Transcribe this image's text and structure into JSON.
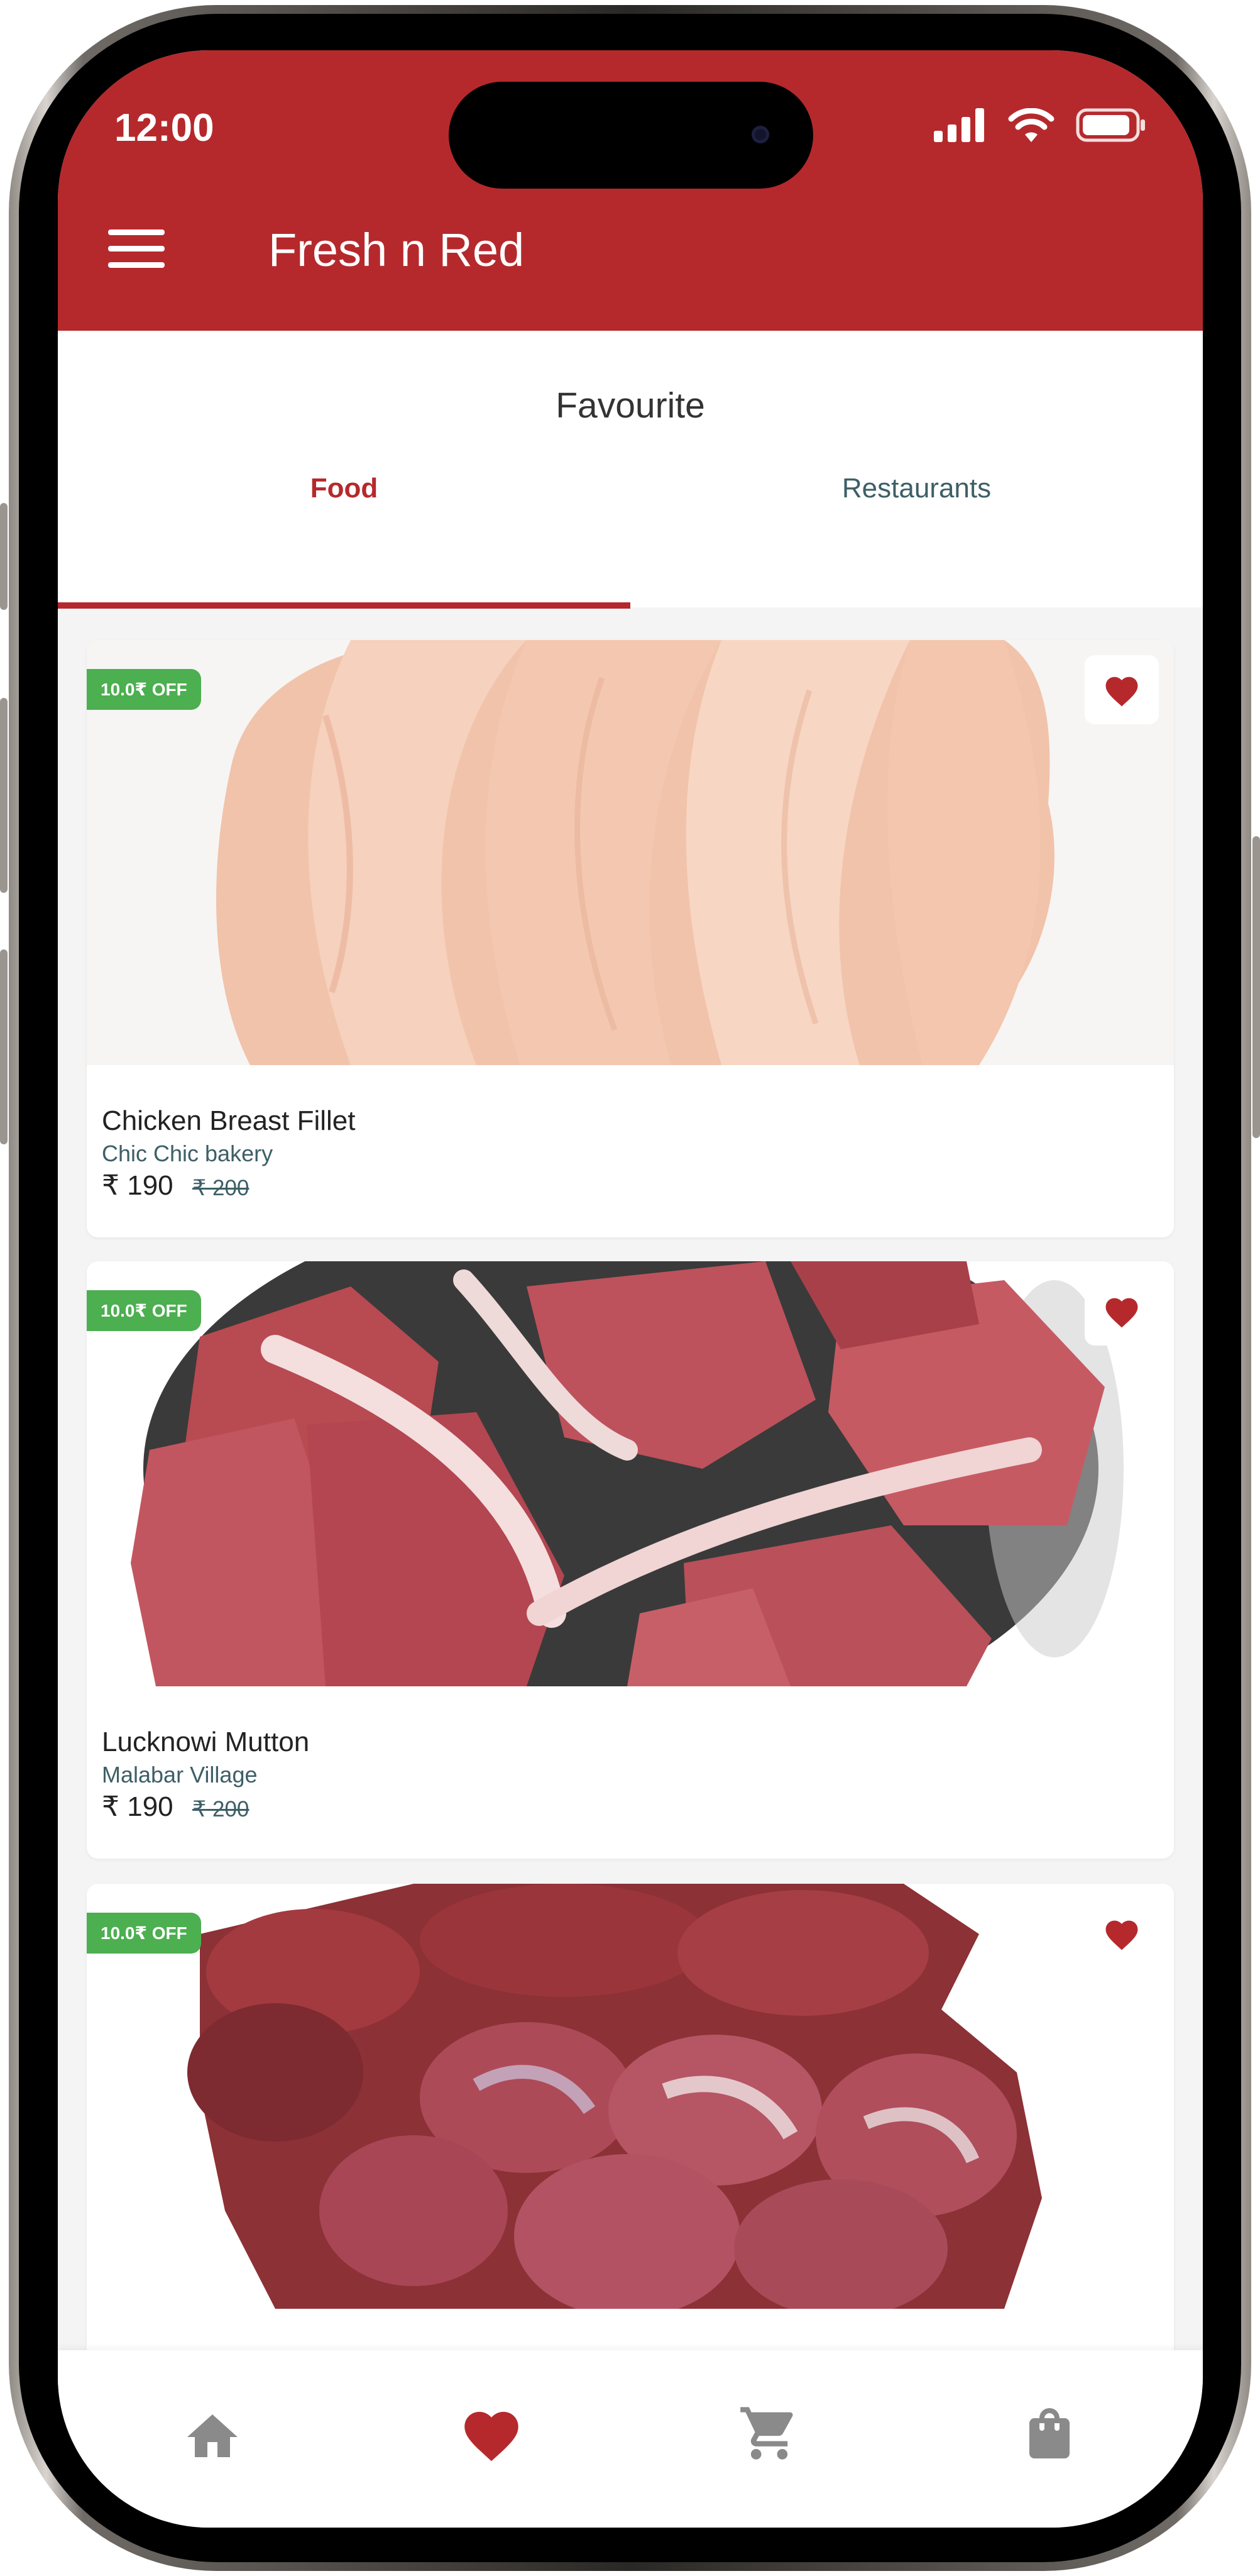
{
  "status_bar": {
    "time": "12:00"
  },
  "app_bar": {
    "title": "Fresh n Red"
  },
  "page": {
    "title": "Favourite"
  },
  "tabs": [
    {
      "label": "Food",
      "active": true
    },
    {
      "label": "Restaurants",
      "active": false
    }
  ],
  "items": [
    {
      "name": "Chicken Breast Fillet",
      "shop": "Chic Chic bakery",
      "price": "₹ 190",
      "old_price": "₹ 200",
      "discount": "10.0₹ OFF",
      "image": "chicken-breast-fillet"
    },
    {
      "name": "Lucknowi Mutton",
      "shop": "Malabar Village",
      "price": "₹ 190",
      "old_price": "₹ 200",
      "discount": "10.0₹ OFF",
      "image": "mutton-pieces"
    },
    {
      "name": "",
      "shop": "",
      "price": "",
      "old_price": "",
      "discount": "10.0₹ OFF",
      "image": "chicken-liver-gizzard"
    }
  ],
  "bottom_nav": [
    {
      "icon": "home-icon",
      "active": false
    },
    {
      "icon": "heart-icon",
      "active": true
    },
    {
      "icon": "cart-icon",
      "active": false
    },
    {
      "icon": "shopping-bag-icon",
      "active": false
    }
  ],
  "colors": {
    "brand": "#b5292c",
    "discount": "#4caf50",
    "secondary_text": "#3d5f66",
    "inactive_icon": "#8a8a8a"
  }
}
